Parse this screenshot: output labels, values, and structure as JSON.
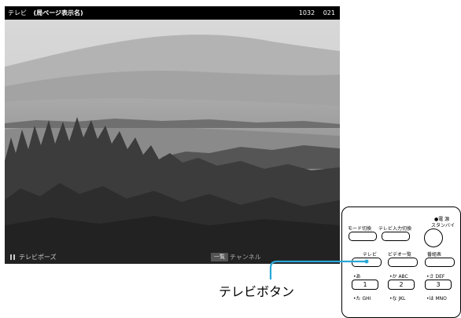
{
  "tv": {
    "top_bar_label": "テレビ",
    "top_bar_channel": "(局ページ表示名)",
    "top_bar_num_1": "1032",
    "top_bar_num_2": "021",
    "bottom_bar_label": "テレビポーズ",
    "bottom_bar_button": "一覧",
    "bottom_bar_channel_label": "チャンネル"
  },
  "remote": {
    "mode_switch": "モード切換",
    "tv_input_switch": "テレビ入力切換",
    "power_dot": "●電 源",
    "standby": "スタンバイ",
    "tv": "テレビ",
    "video_list": "ビデオ一覧",
    "program_guide": "番組表",
    "keys": [
      {
        "caption": "•あ",
        "num": "1"
      },
      {
        "caption": "•か ABC",
        "num": "2"
      },
      {
        "caption": "•さ DEF",
        "num": "3"
      }
    ],
    "bottom_row": [
      "•た GHI",
      "•な JKL",
      "•は MNO"
    ]
  },
  "callout": {
    "label": "テレビボタン"
  }
}
